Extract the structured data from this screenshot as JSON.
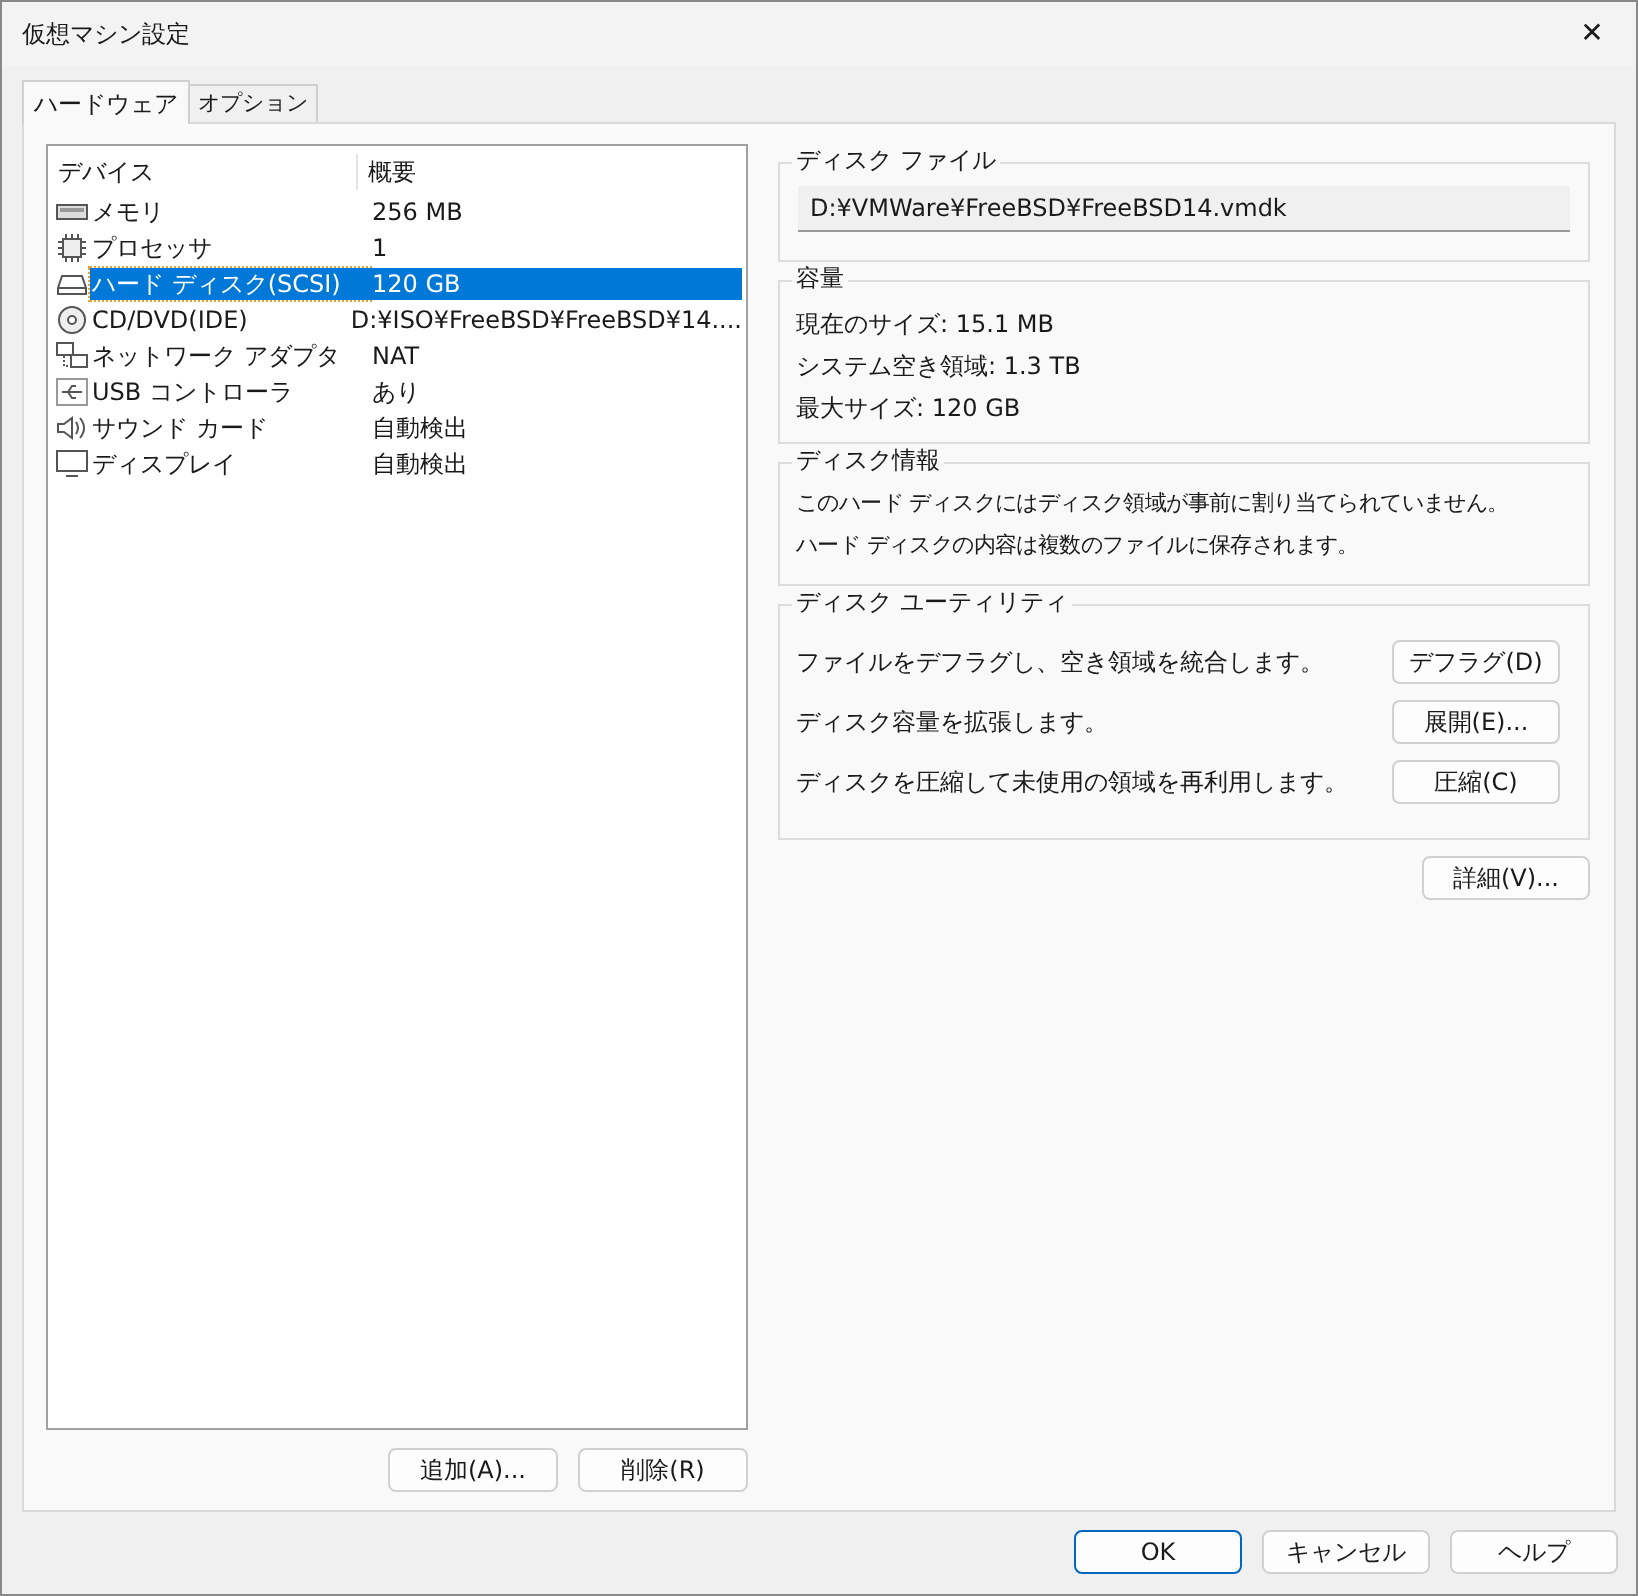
{
  "window": {
    "title": "仮想マシン設定",
    "close": "✕"
  },
  "tabs": [
    {
      "label": "ハードウェア",
      "selected": true
    },
    {
      "label": "オプション",
      "selected": false
    }
  ],
  "device_table": {
    "columns": [
      "デバイス",
      "概要"
    ],
    "rows": [
      {
        "kind": "memory",
        "device": "メモリ",
        "summary": "256 MB",
        "selected": false
      },
      {
        "kind": "processor",
        "device": "プロセッサ",
        "summary": "1",
        "selected": false
      },
      {
        "kind": "disk",
        "device": "ハード ディスク(SCSI)",
        "summary": "120 GB",
        "selected": true
      },
      {
        "kind": "cd",
        "device": "CD/DVD(IDE)",
        "summary": "D:¥ISO¥FreeBSD¥FreeBSD¥14....",
        "selected": false
      },
      {
        "kind": "network",
        "device": "ネットワーク アダプタ",
        "summary": "NAT",
        "selected": false
      },
      {
        "kind": "usb",
        "device": "USB コントローラ",
        "summary": "あり",
        "selected": false
      },
      {
        "kind": "sound",
        "device": "サウンド カード",
        "summary": "自動検出",
        "selected": false
      },
      {
        "kind": "display",
        "device": "ディスプレイ",
        "summary": "自動検出",
        "selected": false
      }
    ]
  },
  "list_buttons": [
    "追加(A)...",
    "削除(R)"
  ],
  "disk_file": {
    "title": "ディスク ファイル",
    "value": "D:¥VMWare¥FreeBSD¥FreeBSD14.vmdk"
  },
  "capacity": {
    "title": "容量",
    "lines": [
      "現在のサイズ: 15.1 MB",
      "システム空き領域: 1.3 TB",
      "最大サイズ: 120 GB"
    ]
  },
  "disk_info": {
    "title": "ディスク情報",
    "lines": [
      "このハード ディスクにはディスク領域が事前に割り当てられていません。",
      "ハード ディスクの内容は複数のファイルに保存されます。"
    ]
  },
  "disk_utility": {
    "title": "ディスク ユーティリティ",
    "rows": [
      {
        "text": "ファイルをデフラグし、空き領域を統合します。",
        "button": "デフラグ(D)"
      },
      {
        "text": "ディスク容量を拡張します。",
        "button": "展開(E)..."
      },
      {
        "text": "ディスクを圧縮して未使用の領域を再利用します。",
        "button": "圧縮(C)"
      }
    ]
  },
  "advanced_button": "詳細(V)...",
  "dialog_buttons": [
    {
      "label": "OK",
      "default": true
    },
    {
      "label": "キャンセル",
      "default": false
    },
    {
      "label": "ヘルプ",
      "default": false
    }
  ]
}
